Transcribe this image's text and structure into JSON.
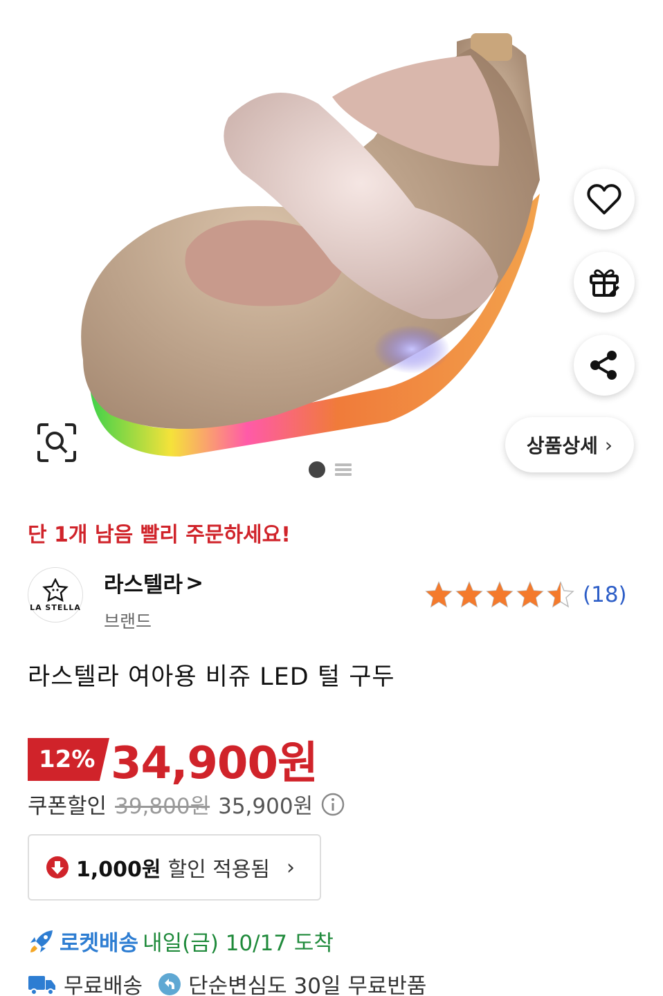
{
  "hero": {
    "detail_button": "상품상세",
    "detail_chevron": "›"
  },
  "urgency": "단 1개 남음 빨리 주문하세요!",
  "brand": {
    "logo_text": "LA STELLA",
    "name": "라스텔라",
    "chevron": ">",
    "subtitle": "브랜드"
  },
  "rating": {
    "value": 4.5,
    "count": "(18)",
    "star_color": "#f47a2c"
  },
  "product_title": "라스텔라 여아용 비쥬 LED 털 구두",
  "price": {
    "discount": "12%",
    "final": "34,900원",
    "coupon_label": "쿠폰할인",
    "original": "39,800원",
    "before_coupon": "35,900원",
    "accent_color": "#d0232a"
  },
  "coupon_box": {
    "amount": "1,000원",
    "text": "할인 적용됨",
    "chevron": "›"
  },
  "delivery": {
    "rocket_label": "로켓배송",
    "date_text": "내일(금) 10/17 도착",
    "free_shipping": "무료배송",
    "free_return": "단순변심도 30일 무료반품"
  }
}
